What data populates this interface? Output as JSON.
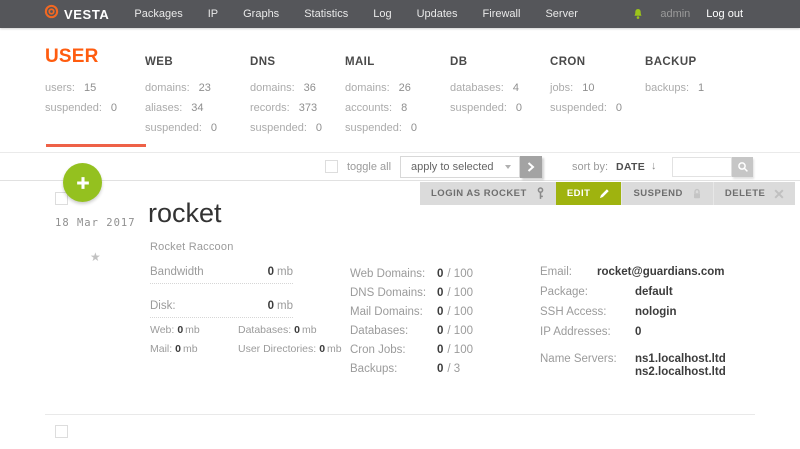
{
  "topbar": {
    "brand": "VESTA",
    "menu": [
      "Packages",
      "IP",
      "Graphs",
      "Statistics",
      "Log",
      "Updates",
      "Firewall",
      "Server"
    ],
    "user": "admin",
    "logout": "Log out"
  },
  "stats": {
    "sections": [
      {
        "title": "USER",
        "active": true,
        "rows": [
          [
            "users:",
            "15"
          ],
          [
            "suspended:",
            "0"
          ]
        ]
      },
      {
        "title": "WEB",
        "active": false,
        "rows": [
          [
            "domains:",
            "23"
          ],
          [
            "aliases:",
            "34"
          ],
          [
            "suspended:",
            "0"
          ]
        ]
      },
      {
        "title": "DNS",
        "active": false,
        "rows": [
          [
            "domains:",
            "36"
          ],
          [
            "records:",
            "373"
          ],
          [
            "suspended:",
            "0"
          ]
        ]
      },
      {
        "title": "MAIL",
        "active": false,
        "rows": [
          [
            "domains:",
            "26"
          ],
          [
            "accounts:",
            "8"
          ],
          [
            "suspended:",
            "0"
          ]
        ]
      },
      {
        "title": "DB",
        "active": false,
        "rows": [
          [
            "databases:",
            "4"
          ],
          [
            "suspended:",
            "0"
          ]
        ]
      },
      {
        "title": "CRON",
        "active": false,
        "rows": [
          [
            "jobs:",
            "10"
          ],
          [
            "suspended:",
            "0"
          ]
        ]
      },
      {
        "title": "BACKUP",
        "active": false,
        "rows": [
          [
            "backups:",
            "1"
          ]
        ]
      }
    ]
  },
  "toolbar": {
    "toggle_all_label": "toggle all",
    "bulk_action_selected": "apply to selected",
    "sort_label": "sort by:",
    "sort_value": "DATE",
    "sort_direction": "↓",
    "search_value": ""
  },
  "actions": {
    "login": "LOGIN AS ROCKET",
    "edit": "EDIT",
    "suspend": "SUSPEND",
    "delete": "DELETE"
  },
  "user_row": {
    "date": "18 Mar 2017",
    "username": "rocket",
    "full_name": "Rocket Raccoon",
    "usage": {
      "bandwidth": {
        "label": "Bandwidth",
        "value": "0",
        "unit": "mb"
      },
      "disk": {
        "label": "Disk:",
        "value": "0",
        "unit": "mb"
      },
      "disk_breakdown": [
        {
          "label": "Web:",
          "value": "0",
          "unit": "mb"
        },
        {
          "label": "Databases:",
          "value": "0",
          "unit": "mb"
        },
        {
          "label": "Mail:",
          "value": "0",
          "unit": "mb"
        },
        {
          "label": "User Directories:",
          "value": "0",
          "unit": "mb"
        }
      ]
    },
    "quotas": [
      {
        "label": "Web Domains:",
        "used": "0",
        "limit": "100"
      },
      {
        "label": "DNS Domains:",
        "used": "0",
        "limit": "100"
      },
      {
        "label": "Mail Domains:",
        "used": "0",
        "limit": "100"
      },
      {
        "label": "Databases:",
        "used": "0",
        "limit": "100"
      },
      {
        "label": "Cron Jobs:",
        "used": "0",
        "limit": "100"
      },
      {
        "label": "Backups:",
        "used": "0",
        "limit": "3"
      }
    ],
    "details": [
      {
        "label": "Email:",
        "values": [
          "rocket@guardians.com"
        ]
      },
      {
        "label": "Package:",
        "values": [
          "default"
        ]
      },
      {
        "label": "SSH Access:",
        "values": [
          "nologin"
        ]
      },
      {
        "label": "IP Addresses:",
        "values": [
          "0"
        ]
      },
      {
        "label": "Name Servers:",
        "values": [
          "ns1.localhost.ltd",
          "ns2.localhost.ltd"
        ]
      }
    ]
  },
  "colors": {
    "topbar_bg": "#55565a",
    "accent_orange": "#ff5c0f",
    "underline_orange": "#ee6147",
    "accent_green": "#9fb30f",
    "add_button_green": "#94c11f"
  }
}
